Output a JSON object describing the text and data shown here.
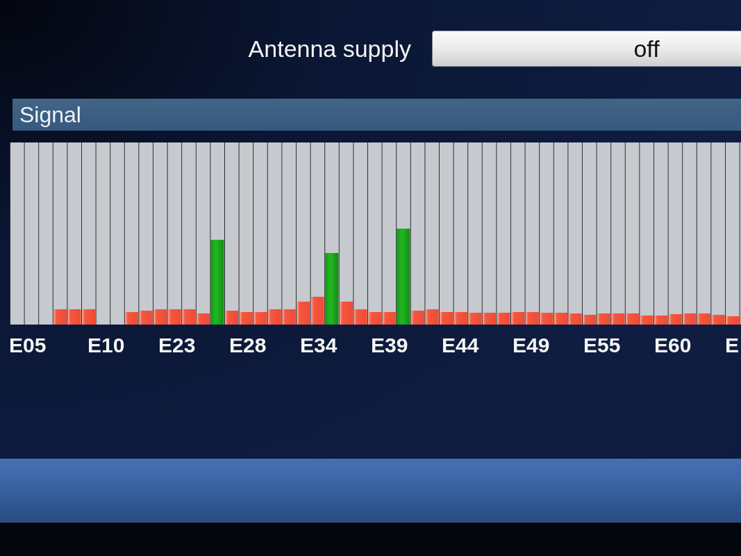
{
  "antenna_supply": {
    "label": "Antenna supply",
    "value": "off"
  },
  "signal": {
    "title": "Signal",
    "channel_labels": [
      "E05",
      "E10",
      "E23",
      "E28",
      "E34",
      "E39",
      "E44",
      "E49",
      "E55",
      "E60",
      "E"
    ]
  }
}
